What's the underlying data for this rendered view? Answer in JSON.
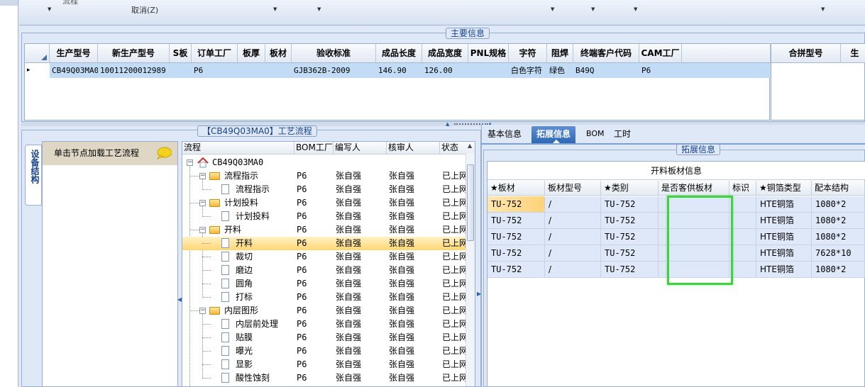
{
  "ribbon": {
    "cancel_label": "取消(Z)",
    "frag_label": "流程"
  },
  "main_info": {
    "title": "主要信息",
    "columns": [
      "生产型号",
      "新生产型号",
      "S板",
      "订单工厂",
      "板厚",
      "板材",
      "验收标准",
      "成品长度",
      "成品宽度",
      "PNL规格",
      "字符",
      "阻焊",
      "终端客户代码",
      "CAM工厂"
    ],
    "row": {
      "marker": "▸",
      "cells": [
        "CB49Q03MA0",
        "10011200012989",
        "",
        "P6",
        "",
        "",
        "GJB362B-2009",
        "146.90",
        "126.00",
        "",
        "白色字符",
        "绿色",
        "B49Q",
        "P6"
      ]
    },
    "merge_columns": [
      "合拼型号",
      "生"
    ]
  },
  "process": {
    "title": "【CB49Q03MA0】工艺流程",
    "side_tab": "设备结构",
    "left_hint": "单击节点加载工艺流程",
    "columns": [
      "流程",
      "BOM工厂",
      "编写人",
      "核审人",
      "状态"
    ],
    "rows": [
      {
        "name": "CB49Q03MA0",
        "level": 0,
        "kind": "root",
        "factory": "",
        "writer": "",
        "reviewer": "",
        "status": ""
      },
      {
        "name": "流程指示",
        "level": 1,
        "kind": "folder",
        "factory": "P6",
        "writer": "张自强",
        "reviewer": "张自强",
        "status": "已上网"
      },
      {
        "name": "流程指示",
        "level": 2,
        "kind": "doc",
        "factory": "P6",
        "writer": "张自强",
        "reviewer": "张自强",
        "status": "已上网"
      },
      {
        "name": "计划投料",
        "level": 1,
        "kind": "folder",
        "factory": "P6",
        "writer": "张自强",
        "reviewer": "张自强",
        "status": "已上网"
      },
      {
        "name": "计划投料",
        "level": 2,
        "kind": "doc",
        "factory": "P6",
        "writer": "张自强",
        "reviewer": "张自强",
        "status": "已上网"
      },
      {
        "name": "开料",
        "level": 1,
        "kind": "folder",
        "factory": "P6",
        "writer": "张自强",
        "reviewer": "张自强",
        "status": "已上网"
      },
      {
        "name": "开料",
        "level": 2,
        "kind": "doc",
        "factory": "P6",
        "writer": "张自强",
        "reviewer": "张自强",
        "status": "已上网",
        "selected": true
      },
      {
        "name": "裁切",
        "level": 2,
        "kind": "doc",
        "factory": "P6",
        "writer": "张自强",
        "reviewer": "张自强",
        "status": "已上网"
      },
      {
        "name": "磨边",
        "level": 2,
        "kind": "doc",
        "factory": "P6",
        "writer": "张自强",
        "reviewer": "张自强",
        "status": "已上网"
      },
      {
        "name": "圆角",
        "level": 2,
        "kind": "doc",
        "factory": "P6",
        "writer": "张自强",
        "reviewer": "张自强",
        "status": "已上网"
      },
      {
        "name": "打标",
        "level": 2,
        "kind": "doc",
        "factory": "P6",
        "writer": "张自强",
        "reviewer": "张自强",
        "status": "已上网"
      },
      {
        "name": "内层图形",
        "level": 1,
        "kind": "folder",
        "factory": "P6",
        "writer": "张自强",
        "reviewer": "张自强",
        "status": "已上网"
      },
      {
        "name": "内层前处理",
        "level": 2,
        "kind": "doc",
        "factory": "P6",
        "writer": "张自强",
        "reviewer": "张自强",
        "status": "已上网"
      },
      {
        "name": "贴膜",
        "level": 2,
        "kind": "doc",
        "factory": "P6",
        "writer": "张自强",
        "reviewer": "张自强",
        "status": "已上网"
      },
      {
        "name": "曝光",
        "level": 2,
        "kind": "doc",
        "factory": "P6",
        "writer": "张自强",
        "reviewer": "张自强",
        "status": "已上网"
      },
      {
        "name": "显影",
        "level": 2,
        "kind": "doc",
        "factory": "P6",
        "writer": "张自强",
        "reviewer": "张自强",
        "status": "已上网"
      },
      {
        "name": "酸性蚀刻",
        "level": 2,
        "kind": "doc",
        "factory": "P6",
        "writer": "张自强",
        "reviewer": "张自强",
        "status": "已上网"
      }
    ]
  },
  "info_tabs": [
    {
      "label": "基本信息",
      "active": false
    },
    {
      "label": "拓展信息",
      "active": true
    },
    {
      "label": "BOM",
      "active": false
    },
    {
      "label": "工时",
      "active": false
    }
  ],
  "extended": {
    "title": "拓展信息",
    "grid_title": "开料板材信息",
    "columns": [
      "★板材",
      "板材型号",
      "★类别",
      "是否客供板材",
      "标识",
      "★铜箔类型",
      "配本结构"
    ],
    "rows": [
      [
        "TU-752",
        "/",
        "TU-752",
        "",
        "",
        "HTE铜箔",
        "1080*2"
      ],
      [
        "TU-752",
        "/",
        "TU-752",
        "",
        "",
        "HTE铜箔",
        "1080*2"
      ],
      [
        "TU-752",
        "/",
        "TU-752",
        "",
        "",
        "HTE铜箔",
        "1080*2"
      ],
      [
        "TU-752",
        "/",
        "TU-752",
        "",
        "",
        "HTE铜箔",
        "7628*10"
      ],
      [
        "TU-752",
        "/",
        "TU-752",
        "",
        "",
        "HTE铜箔",
        "1080*2"
      ]
    ]
  },
  "colors": {
    "selected_row": "#c2dcf6",
    "tree_selected": "#ffd673",
    "tab_active": "#2f68b5",
    "highlight_box": "#3fd43f",
    "panel_bg": "#dfe8f6"
  }
}
